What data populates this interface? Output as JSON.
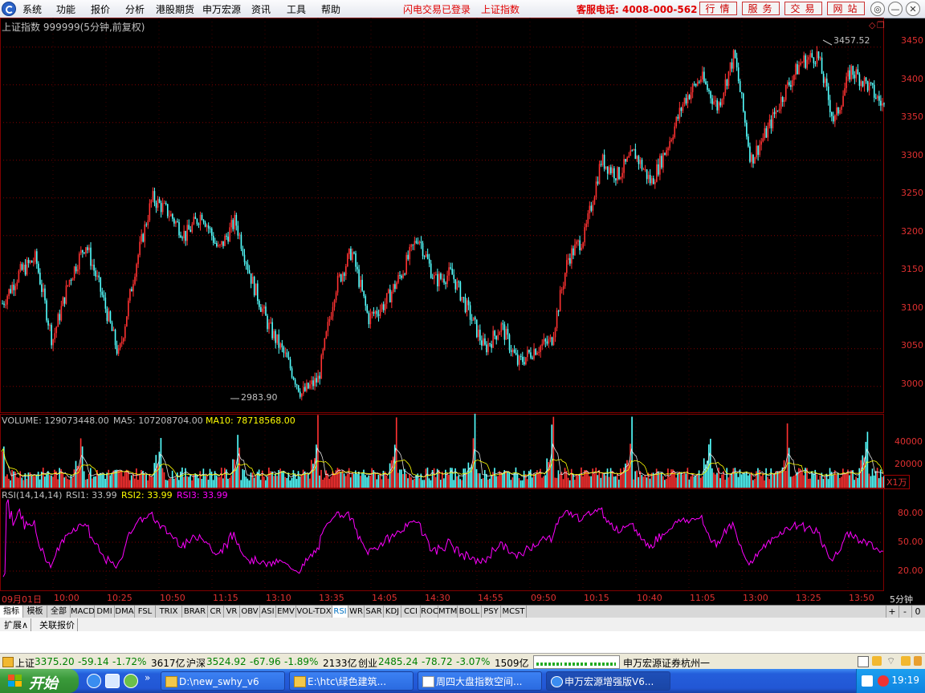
{
  "menu": {
    "items": [
      "系统",
      "功能",
      "报价",
      "分析",
      "港股期货",
      "申万宏源",
      "资讯",
      "工具",
      "帮助"
    ],
    "status_login": "闪电交易已登录",
    "current_index": "上证指数",
    "hotline": "客服电话: 4008-000-562",
    "right_buttons": [
      "行情",
      "服务",
      "交易",
      "网站"
    ]
  },
  "chart": {
    "title": "上证指数 999999(5分钟,前复权)",
    "high_label": "3457.52",
    "low_label": "2983.90",
    "price_ticks": [
      "3450",
      "3400",
      "3350",
      "3300",
      "3250",
      "3200",
      "3150",
      "3100",
      "3050",
      "3000"
    ],
    "volume_header": {
      "vol": "VOLUME: 129073448.00",
      "ma5": "MA5: 107208704.00",
      "ma10": "MA10: 78718568.00"
    },
    "volume_ticks": [
      "40000",
      "20000"
    ],
    "volume_unit": "X1万",
    "rsi_header": {
      "name": "RSI(14,14,14)",
      "rsi1": "RSI1: 33.99",
      "rsi2": "RSI2: 33.99",
      "rsi3": "RSI3: 33.99"
    },
    "rsi_ticks": [
      "80.00",
      "50.00",
      "20.00"
    ],
    "colors": {
      "up": "#ff3232",
      "down": "#54ffff",
      "ma10": "#ffff00",
      "rsi": "#ff00ff",
      "grid": "#800000"
    }
  },
  "chart_data": {
    "type": "line",
    "price_ylim": [
      2970,
      3470
    ],
    "price_path": [
      3110,
      3150,
      3170,
      3060,
      3140,
      3190,
      3120,
      3040,
      3160,
      3250,
      3230,
      3200,
      3230,
      3180,
      3220,
      3140,
      3080,
      3040,
      2990,
      3010,
      3130,
      3180,
      3090,
      3110,
      3150,
      3200,
      3140,
      3150,
      3100,
      3050,
      3080,
      3030,
      3050,
      3060,
      3170,
      3200,
      3300,
      3280,
      3310,
      3270,
      3320,
      3380,
      3410,
      3370,
      3440,
      3300,
      3340,
      3390,
      3430,
      3440,
      3350,
      3420,
      3400,
      3370
    ],
    "high": 3457.52,
    "low": 2983.9,
    "time_labels": [
      "09月01日",
      "10:00",
      "10:25",
      "10:50",
      "11:15",
      "13:10",
      "13:35",
      "14:05",
      "14:30",
      "14:55",
      "09:50",
      "10:15",
      "10:40",
      "11:05",
      "13:00",
      "13:25",
      "13:50"
    ],
    "period": "5分钟",
    "volume_ylim": [
      0,
      50000
    ],
    "rsi_ylim": [
      0,
      100
    ],
    "rsi_value": 33.99
  },
  "time_axis": {
    "labels": [
      "09月01日",
      "10:00",
      "10:25",
      "10:50",
      "11:15",
      "13:10",
      "13:35",
      "14:05",
      "14:30",
      "14:55",
      "09:50",
      "10:15",
      "10:40",
      "11:05",
      "13:00",
      "13:25",
      "13:50"
    ],
    "period": "5分钟"
  },
  "indicator_tabs": [
    "指标",
    "模板",
    "全部",
    "MACD",
    "DMI",
    "DMA",
    "FSL",
    "TRIX",
    "BRAR",
    "CR",
    "VR",
    "OBV",
    "ASI",
    "EMV",
    "VOL-TDX",
    "RSI",
    "WR",
    "SAR",
    "KDJ",
    "CCI",
    "ROC",
    "MTM",
    "BOLL",
    "PSY",
    "MCST"
  ],
  "zoom_controls": [
    "+",
    "-",
    "0"
  ],
  "sub_tabs": [
    "扩展∧",
    "关联报价"
  ],
  "status": {
    "sh_name": "上证",
    "sh_val": "3375.20",
    "sh_chg": "-59.14",
    "sh_pct": "-1.72%",
    "sh_amt": "3617亿",
    "hs_name": "沪深",
    "hs_val": "3524.92",
    "hs_chg": "-67.96",
    "hs_pct": "-1.89%",
    "hs_amt": "2133亿",
    "cy_name": "创业",
    "cy_val": "2485.24",
    "cy_chg": "-78.72",
    "cy_pct": "-3.07%",
    "cy_amt": "1509亿",
    "broker": "申万宏源证券杭州一"
  },
  "taskbar": {
    "start": "开始",
    "tasks": [
      "D:\\new_swhy_v6",
      "E:\\htc\\绿色建筑...",
      "周四大盘指数空间...",
      "申万宏源增强版V6..."
    ],
    "clock": "19:19"
  }
}
